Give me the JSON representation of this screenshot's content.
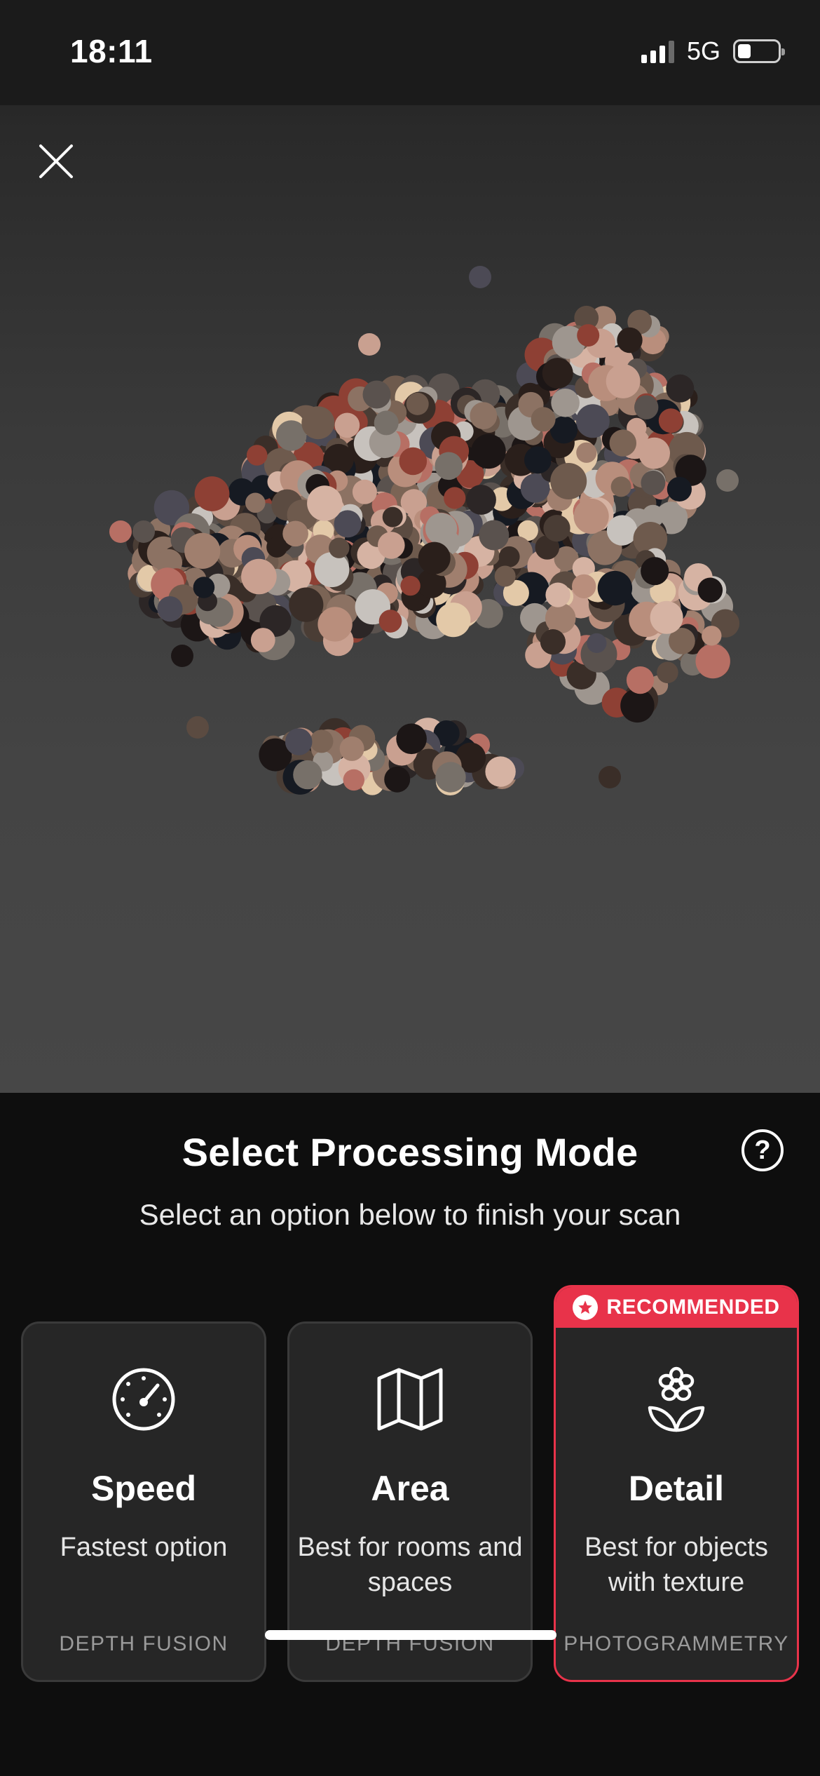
{
  "status_bar": {
    "time": "18:11",
    "network": "5G",
    "battery_level": 0.3
  },
  "icons": {
    "close": "close-icon",
    "help": "help-icon",
    "speed": "speedometer-icon",
    "area": "map-icon",
    "detail": "flower-icon",
    "recommended": "star-icon"
  },
  "sheet": {
    "title": "Select Processing Mode",
    "subtitle": "Select an option below to finish your scan",
    "help_label": "?"
  },
  "options": [
    {
      "title": "Speed",
      "description": "Fastest option",
      "method": "DEPTH FUSION"
    },
    {
      "title": "Area",
      "description": "Best for rooms and spaces",
      "method": "DEPTH FUSION"
    },
    {
      "title": "Detail",
      "description": "Best for objects with texture",
      "method": "PHOTOGRAMMETRY",
      "badge": "RECOMMENDED"
    }
  ],
  "colors": {
    "accent": "#e8334a",
    "card_bg": "#262626",
    "sheet_bg": "#0e0e0e",
    "muted_text": "#9b9b9b"
  }
}
